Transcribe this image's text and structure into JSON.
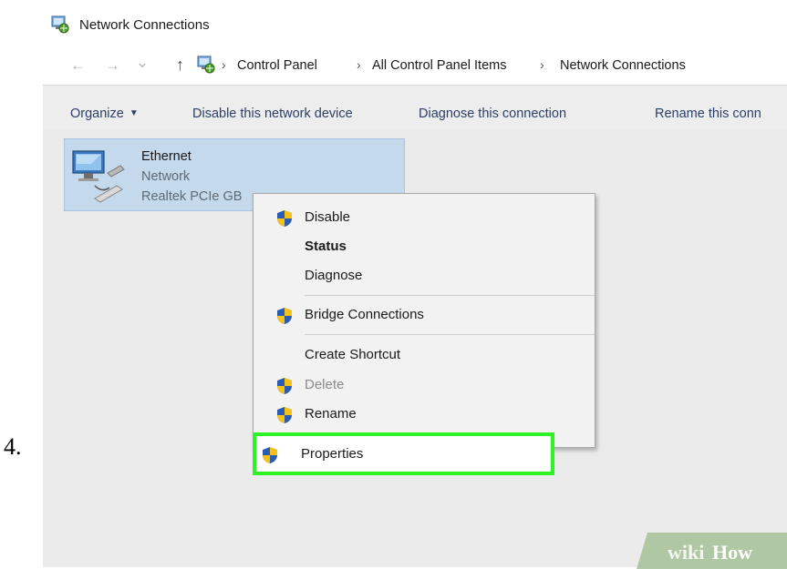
{
  "step_number": "4.",
  "window": {
    "title": "Network Connections",
    "title_icon": "network-connections-icon"
  },
  "address": {
    "icon": "network-connections-icon",
    "breadcrumbs": [
      "Control Panel",
      "All Control Panel Items",
      "Network Connections"
    ],
    "separator": "›"
  },
  "nav": {
    "back": "←",
    "forward": "→",
    "recent": "⌄",
    "up": "↑"
  },
  "toolbar": {
    "organize": "Organize",
    "disable_device": "Disable this network device",
    "diagnose": "Diagnose this connection",
    "rename": "Rename this conn"
  },
  "adapter": {
    "name": "Ethernet",
    "network": "Network",
    "device": "Realtek PCIe GB",
    "icon": "ethernet-adapter-icon"
  },
  "context_menu": {
    "items": [
      {
        "label": "Disable",
        "icon": "uac-shield-icon",
        "bold": false,
        "disabled": false
      },
      {
        "label": "Status",
        "icon": null,
        "bold": true,
        "disabled": false
      },
      {
        "label": "Diagnose",
        "icon": null,
        "bold": false,
        "disabled": false
      },
      {
        "label": "Bridge Connections",
        "icon": "uac-shield-icon",
        "bold": false,
        "disabled": false
      },
      {
        "label": "Create Shortcut",
        "icon": null,
        "bold": false,
        "disabled": false
      },
      {
        "label": "Delete",
        "icon": "uac-shield-icon",
        "bold": false,
        "disabled": true
      },
      {
        "label": "Rename",
        "icon": "uac-shield-icon",
        "bold": false,
        "disabled": false
      },
      {
        "label": "Properties",
        "icon": "uac-shield-icon",
        "bold": false,
        "disabled": false
      }
    ],
    "highlight_color": "#2ef224"
  },
  "watermark": {
    "text_wiki": "wiki",
    "text_how": "How"
  },
  "colors": {
    "selection": "#c5d9ec",
    "toolbar_text": "#2c3e66",
    "background": "#ebebeb"
  }
}
